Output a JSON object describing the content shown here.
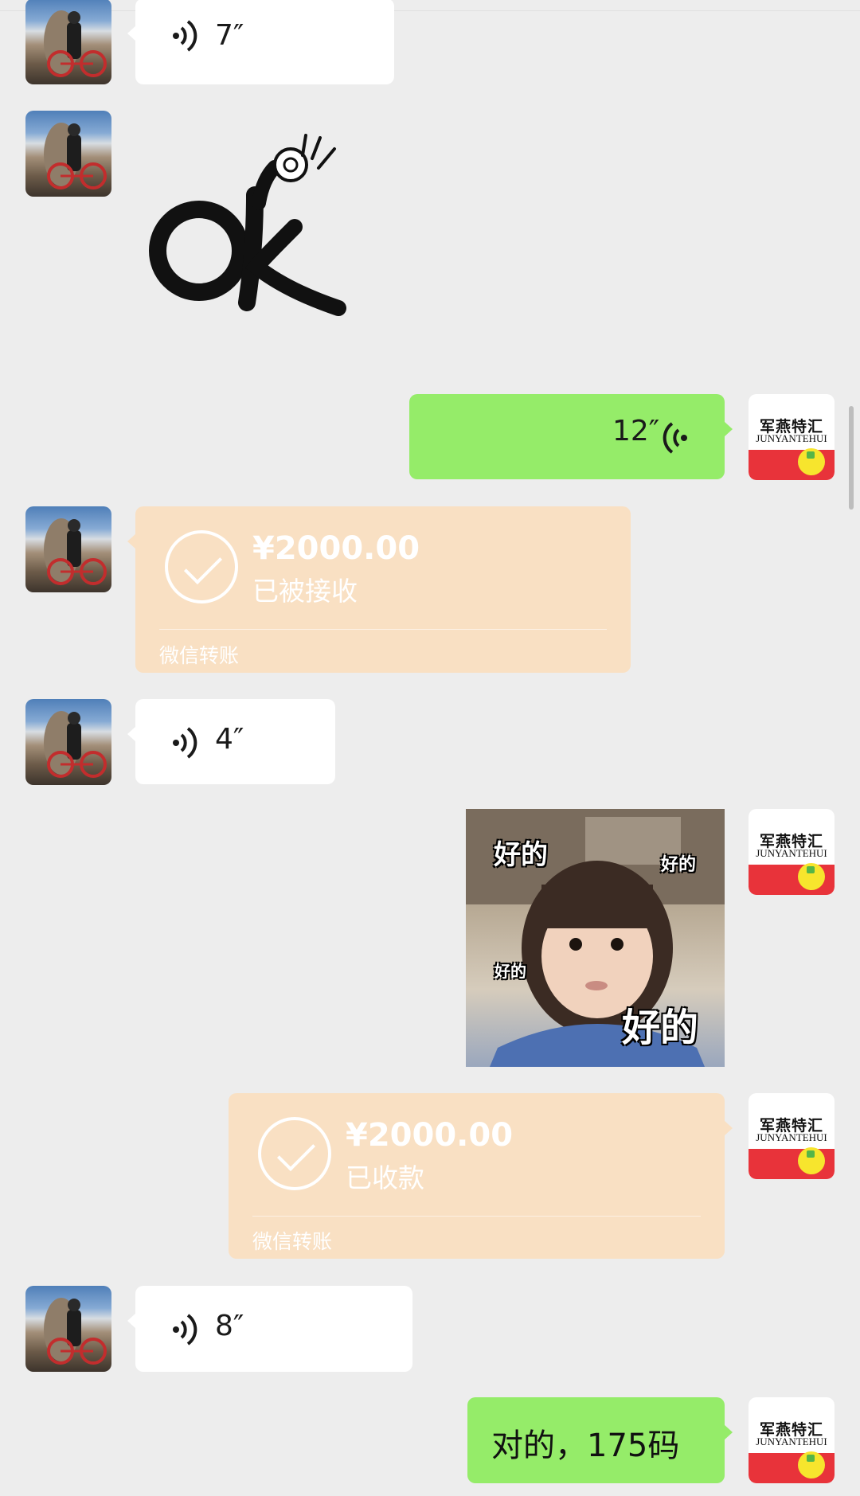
{
  "messages": [
    {
      "side": "left",
      "type": "voice",
      "duration": "7″"
    },
    {
      "side": "left",
      "type": "sticker",
      "sticker": "ok-hand-sticker"
    },
    {
      "side": "right",
      "type": "voice",
      "duration": "12″"
    },
    {
      "side": "left",
      "type": "transfer",
      "amount": "¥2000.00",
      "status": "已被接收",
      "label": "微信转账"
    },
    {
      "side": "left",
      "type": "voice",
      "duration": "4″"
    },
    {
      "side": "right",
      "type": "image",
      "texts": [
        "好的",
        "好的",
        "好的",
        "好的"
      ]
    },
    {
      "side": "right",
      "type": "transfer",
      "amount": "¥2000.00",
      "status": "已收款",
      "label": "微信转账"
    },
    {
      "side": "left",
      "type": "voice",
      "duration": "8″"
    },
    {
      "side": "right",
      "type": "text",
      "text": "对的，175码"
    }
  ],
  "contact_avatar": {
    "brand_cn": "军燕特汇",
    "brand_en": "JUNYANTEHUI"
  },
  "colors": {
    "background": "#ededed",
    "sent_bubble": "#95ec69",
    "received_bubble": "#ffffff",
    "transfer_bubble": "#f9e0c3"
  }
}
